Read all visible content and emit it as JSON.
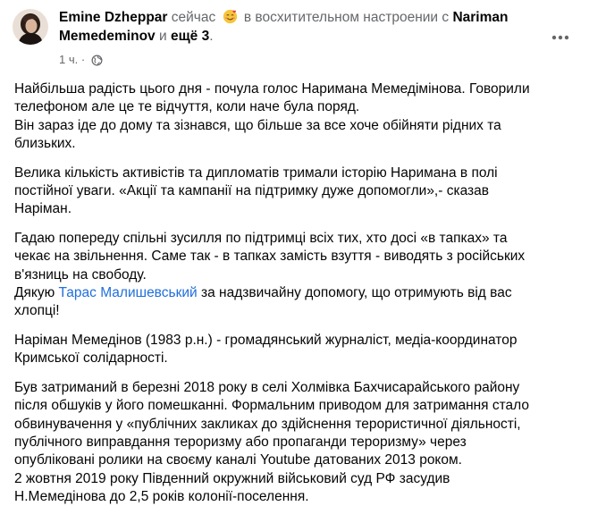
{
  "header": {
    "author": "Emine Dzheppar",
    "time_inline": "сейчас",
    "feeling_icon": "smiling-face-with-hearts-emoji",
    "status_text": "в восхитительном настроении с",
    "tagged_part1": "Nariman",
    "tagged_part2": "Memedeminov",
    "and_text": "и",
    "others": "ещё 3",
    "period": "."
  },
  "meta": {
    "timestamp": "1 ч.",
    "separator": "·",
    "privacy_icon": "globe-icon"
  },
  "more_icon": "ellipsis-icon",
  "colors": {
    "text": "#050505",
    "muted": "#65676b",
    "link": "#216fdb"
  },
  "post": {
    "p1": [
      "Найбільша радість цього дня - почула голос Наримана Мемедімінова. Говорили",
      "телефоном але це те відчуття, коли наче була поряд.",
      "Він зараз іде до дому та зізнався, що більше за все хоче обійняти рідних та",
      "близьких."
    ],
    "p2": [
      "Велика кількість активістів та дипломатів тримали історію Наримана в полі",
      "постійної уваги. «Акції та кампанії на підтримку дуже допомогли»,- сказав",
      "Наріман."
    ],
    "p3": [
      "Гадаю попереду спільні зусилля по підтримці всіх тих, хто досі «в тапках» та",
      "чекає на звільнення. Саме так  - в тапках замість взуття - виводять з російських",
      "в'язниць на свободу."
    ],
    "p3_thanks_before": "Дякую ",
    "p3_mention": "Тарас Малишевський",
    "p3_thanks_after": " за надзвичайну допомогу, що отримують від вас",
    "p3_last": "хлопці!",
    "p4": [
      "Наріман Мемедінов (1983 р.н.) - громадянський журналіст, медіа-координатор",
      "Кримської солідарності."
    ],
    "p5": [
      "Був затриманий в березні 2018 року в селі Холмівка Бахчисарайського району",
      "після обшуків у його помешканні. Формальним приводом для затримання стало",
      "обвинувачення у «публічних закликах до здійснення терористичної діяльності,",
      "публічного виправдання тероризму або пропаганди тероризму» через",
      "опубліковані ролики на своєму каналі Youtube датованих 2013 роком.",
      "2 жовтня 2019 року Південний окружний військовий суд РФ засудив",
      "Н.Мемедінова до 2,5 років колонії-поселення."
    ]
  }
}
